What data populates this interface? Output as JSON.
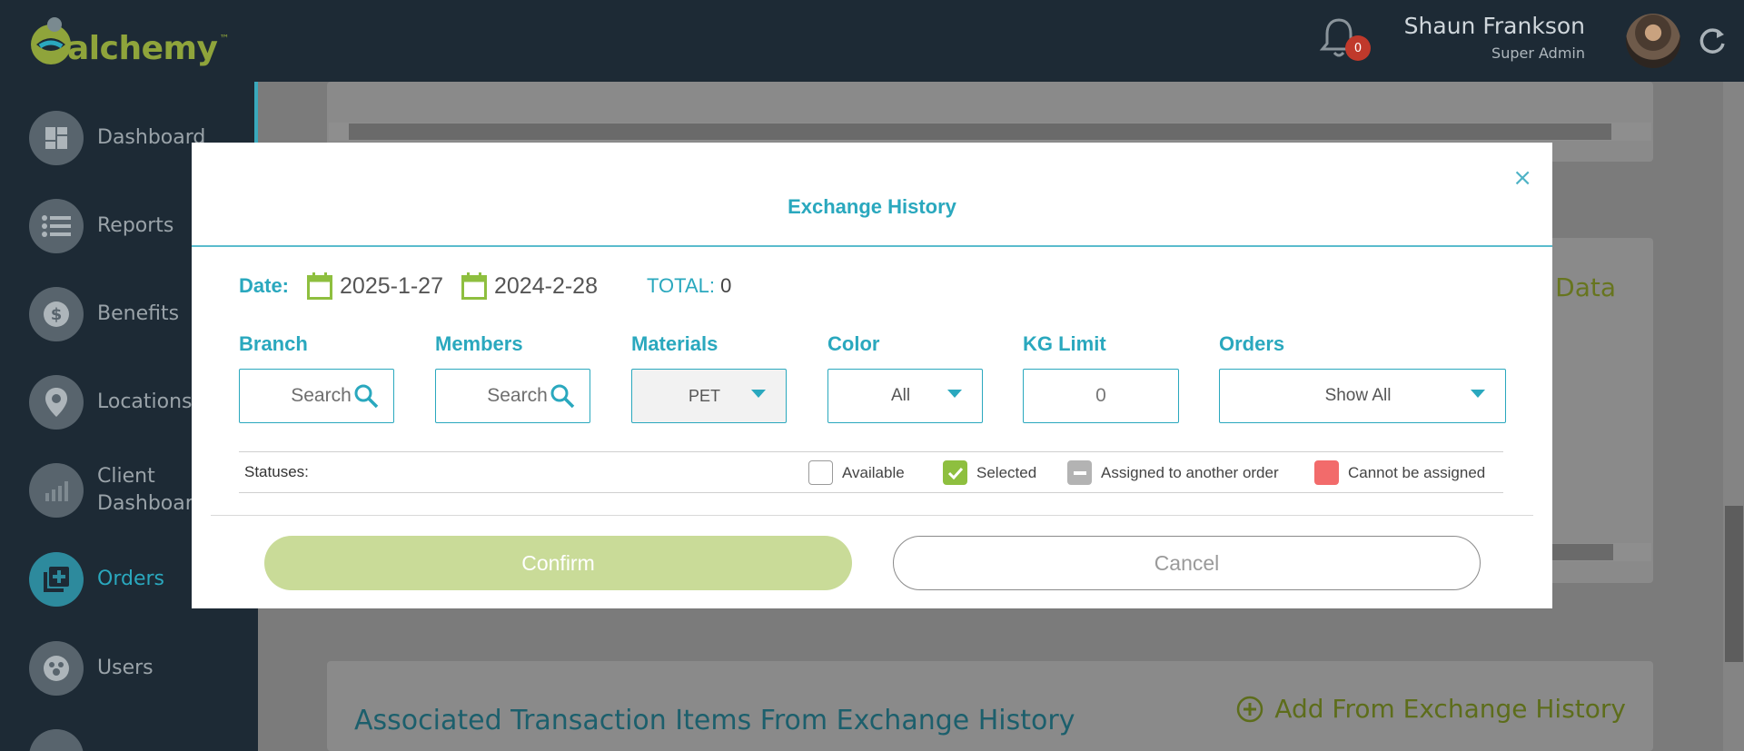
{
  "app": {
    "logo_text": "alchemy",
    "logo_tm": "™",
    "notifications_count": "0",
    "user_name": "Shaun Frankson",
    "user_role": "Super Admin"
  },
  "sidebar": {
    "items": [
      {
        "label": "Dashboard",
        "icon": "dashboard-icon"
      },
      {
        "label": "Reports",
        "icon": "list-icon"
      },
      {
        "label": "Benefits",
        "icon": "dollar-icon"
      },
      {
        "label": "Locations",
        "icon": "location-pin-icon"
      },
      {
        "label_line1": "Client",
        "label_line2": "Dashboard",
        "icon": "chart-icon"
      },
      {
        "label": "Orders",
        "icon": "add-order-icon",
        "active": true
      },
      {
        "label": "Users",
        "icon": "users-icon"
      }
    ]
  },
  "background": {
    "partial_text": "e Data",
    "section_heading": "Associated Transaction Items From Exchange History",
    "add_link": "Add From Exchange History"
  },
  "modal": {
    "title": "Exchange History",
    "close_symbol": "×",
    "date_label": "Date:",
    "date_from": "2025-1-27",
    "date_to": "2024-2-28",
    "total_label": "TOTAL:",
    "total_value": "0",
    "filters": {
      "branch": {
        "label": "Branch",
        "placeholder": "Search"
      },
      "members": {
        "label": "Members",
        "placeholder": "Search"
      },
      "materials": {
        "label": "Materials",
        "value": "PET"
      },
      "color": {
        "label": "Color",
        "value": "All"
      },
      "kg_limit": {
        "label": "KG Limit",
        "value": "0"
      },
      "orders": {
        "label": "Orders",
        "value": "Show All"
      }
    },
    "statuses": {
      "label": "Statuses:",
      "items": [
        {
          "label": "Available",
          "color": "#ffffff"
        },
        {
          "label": "Selected",
          "color": "#8ebf3f"
        },
        {
          "label": "Assigned to another order",
          "color": "#b3b3b3"
        },
        {
          "label": "Cannot be assigned",
          "color": "#f26b6b"
        }
      ]
    },
    "confirm_label": "Confirm",
    "cancel_label": "Cancel"
  },
  "colors": {
    "accent": "#2aa8be",
    "brand_olive": "#8fa43b",
    "sidebar_bg": "#1d2a35",
    "confirm_disabled": "#c9db98"
  }
}
